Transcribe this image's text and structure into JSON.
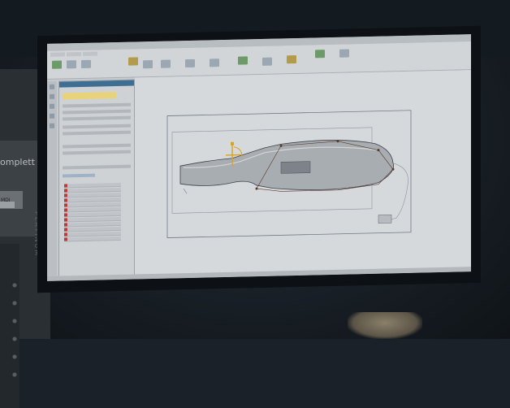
{
  "booth": {
    "partial_word": "omplett",
    "badge_text": "MDI",
    "vertical_brand": "PLATINUM"
  },
  "app": {
    "window_title": "",
    "status_text": ""
  },
  "colors": {
    "screen_bg": "#c7cbcf",
    "panel_header": "#3e6f93",
    "highlight_yellow": "#e8d27a",
    "handle_orange": "#d9a21b",
    "list_flag_red": "#b63c35",
    "model_gray": "#9ea3a7"
  },
  "icons": [
    "projector-screen",
    "cad-bottle-model",
    "selection-handles",
    "ribbon-toolbar-icons"
  ]
}
